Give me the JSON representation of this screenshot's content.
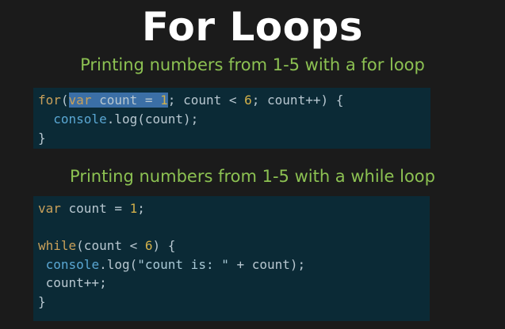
{
  "slide": {
    "title": "For Loops",
    "subtitle_for": "Printing numbers from 1-5 with a for loop",
    "subtitle_while": "Printing numbers from 1-5 with a while loop"
  },
  "code_for": {
    "line1": {
      "kw_for": "for",
      "paren_open": "(",
      "sel_kw": "var",
      "sel_rest": " count = ",
      "sel_num": "1",
      "rest_a": "; count < ",
      "num6": "6",
      "rest_b": "; count++) {"
    },
    "line2": {
      "indent": "  ",
      "fn_console": "console",
      "rest": ".log(count);"
    },
    "line3": "}"
  },
  "code_while": {
    "line1": {
      "kw_var": "var",
      "rest": " count = ",
      "num1": "1",
      "end": ";"
    },
    "line3": {
      "kw_while": "while",
      "rest": "(count < ",
      "num6": "6",
      "end": ") {"
    },
    "line4": {
      "indent": " ",
      "fn_console": "console",
      "rest_a": ".log(",
      "str": "\"count is: \"",
      "rest_b": " + count);"
    },
    "line5": " count++;",
    "line6": "}"
  },
  "colors": {
    "background": "#1b1b1b",
    "title": "#ffffff",
    "subtitle": "#8cc152",
    "code_background": "#0b2a36",
    "code_text": "#b8c7d0",
    "keyword": "#c9a05a",
    "function": "#5aa7d3",
    "selection": "#3b6fa6"
  }
}
